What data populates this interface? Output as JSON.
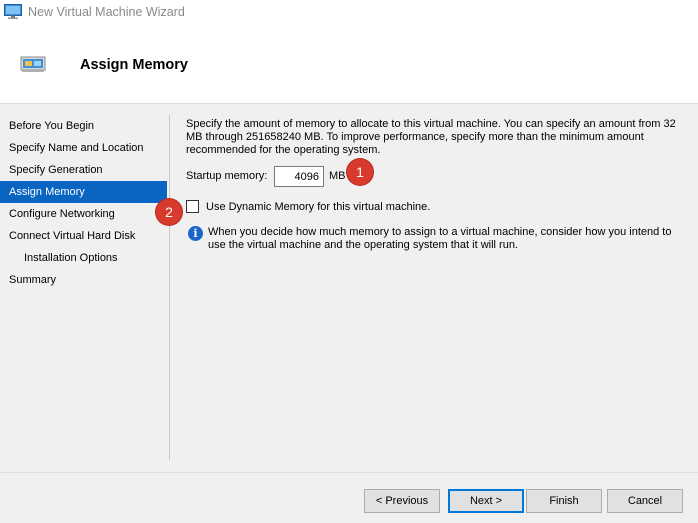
{
  "window": {
    "title": "New Virtual Machine Wizard",
    "icon": "vm-monitor-icon"
  },
  "header": {
    "heading": "Assign Memory",
    "icon": "memory-chip-icon"
  },
  "nav": {
    "items": [
      {
        "label": "Before You Begin"
      },
      {
        "label": "Specify Name and Location"
      },
      {
        "label": "Specify Generation"
      },
      {
        "label": "Assign Memory",
        "active": true
      },
      {
        "label": "Configure Networking"
      },
      {
        "label": "Connect Virtual Hard Disk"
      },
      {
        "label": "Installation Options",
        "sub": true
      },
      {
        "label": "Summary"
      }
    ]
  },
  "content": {
    "intro": "Specify the amount of memory to allocate to this virtual machine. You can specify an amount from 32 MB through 251658240 MB. To improve performance, specify more than the minimum amount recommended for the operating system.",
    "startup_memory_label": "Startup memory:",
    "startup_memory_value": "4096",
    "startup_memory_unit": "MB",
    "dynamic_memory_label": "Use Dynamic Memory for this virtual machine.",
    "dynamic_memory_checked": false,
    "info_text": "When you decide how much memory to assign to a virtual machine, consider how you intend to use the virtual machine and the operating system that it will run."
  },
  "footer": {
    "previous_label": "< Previous",
    "next_label": "Next >",
    "finish_label": "Finish",
    "cancel_label": "Cancel"
  },
  "annotations": {
    "badge1": "1",
    "badge2": "2",
    "color": "#d83a2e"
  },
  "colors": {
    "accent": "#0a64c2",
    "info_icon": "#1a66c9"
  }
}
